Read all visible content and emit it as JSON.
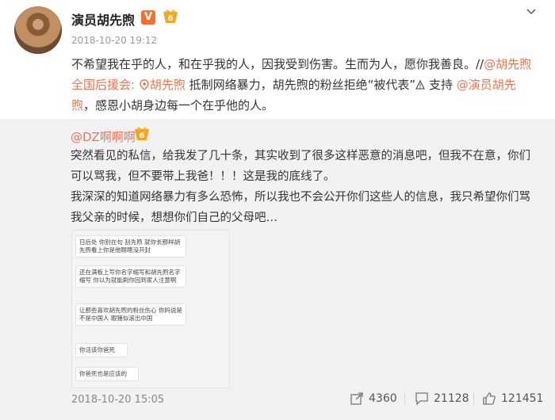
{
  "post": {
    "author": "演员胡先煦",
    "verified_badge": "V",
    "time": "2018-10-20 19:12",
    "text": {
      "p1": "不希望我在乎的人，和在乎我的人，因我受到伤害。生而为人，愿你我善良。//",
      "mention1": "@胡先煦全国后援会:",
      "place": "胡先煦",
      "p2": " 抵制网络暴力，胡先煦的粉丝拒绝“被代表”",
      "p3": " 支持",
      "mention2": "@演员胡先煦",
      "p4": "，感恩小胡身边每一个在乎他的人。"
    }
  },
  "repost": {
    "user": "@DZ啊啊啊",
    "line1": "突然看见的私信，给我发了几十条，其实收到了很多这样恶意的消息吧，但我不在意，你们可以骂我，但不要带上我爸！！！这是我的底线了。",
    "line2": "我深深的知道网络暴力有多么恐怖，所以我也不会公开你们这些人的信息，我只希望你们骂我父亲的时候，想想你们自己的父母吧…",
    "messages": [
      "日后处 你别在句 刮先煦 就你长那样胡先煦看上你是他眼瞎没开封",
      "还在满板上写你名字缩写和胡先煦名字缩写 你以为就能刷你回到家人注意啊",
      "让那些喜欢胡先煦的粉丝伤心 你妈说是不是中国人 跟猪似滚出中国",
      "你活该你爸死",
      "你爸死也是应该的"
    ],
    "time": "2018-10-20 15:05",
    "shares": "4360",
    "comments": "21128",
    "likes": "121451"
  },
  "icons": {
    "chevron": "chevron-down-icon",
    "location": "location-pin-icon",
    "warning": "warning-icon",
    "share": "share-icon",
    "comment": "comment-icon",
    "like": "like-icon",
    "vip": "vip-level-6-icon"
  },
  "colors": {
    "link": "#eb7350",
    "verified": "#f96d2d",
    "repost_bg": "#f2f2f5"
  }
}
